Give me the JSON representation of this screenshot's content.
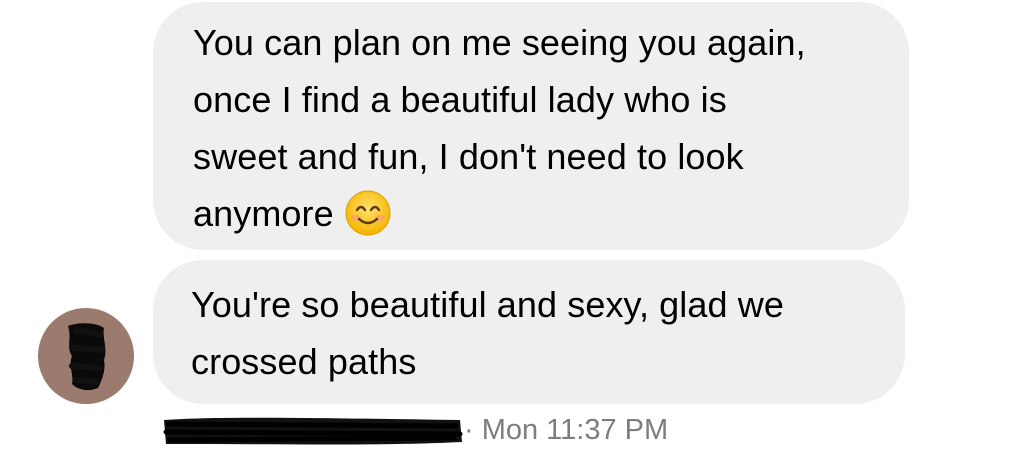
{
  "messages": [
    {
      "lines": [
        "You can plan on me seeing you again,",
        "once I find a beautiful lady who is",
        "sweet and fun, I don't need to look",
        "anymore"
      ],
      "emoji": "smiling-face-with-smiling-eyes-icon"
    },
    {
      "lines": [
        "You're so beautiful and sexy, glad we",
        "crossed paths"
      ]
    }
  ],
  "meta": {
    "timestamp": "· Mon 11:37 PM"
  },
  "colors": {
    "bubble": "#efefef",
    "timestamp": "#7d7d7d",
    "avatar": "#9b7b6d",
    "redaction": "#111111"
  }
}
